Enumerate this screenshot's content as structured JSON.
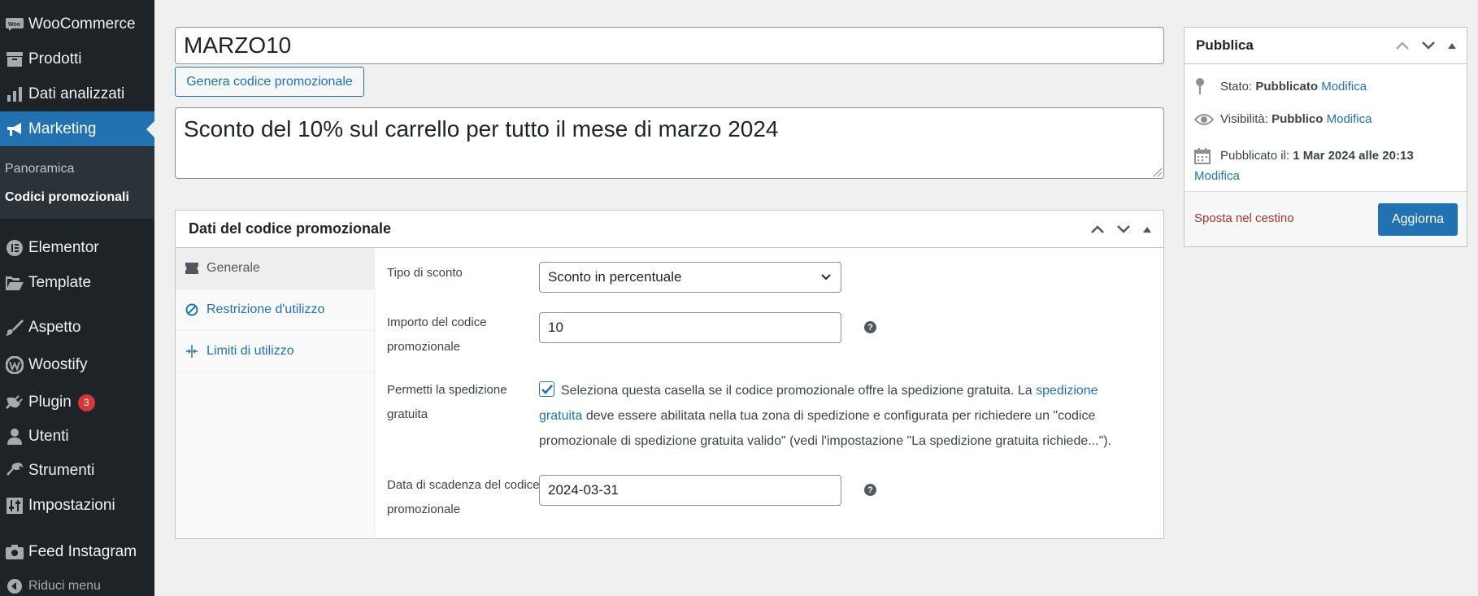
{
  "sidebar": {
    "items": [
      {
        "label": "WooCommerce"
      },
      {
        "label": "Prodotti"
      },
      {
        "label": "Dati analizzati"
      },
      {
        "label": "Marketing"
      },
      {
        "label": "Elementor"
      },
      {
        "label": "Template"
      },
      {
        "label": "Aspetto"
      },
      {
        "label": "Woostify"
      },
      {
        "label": "Plugin",
        "badge": "3"
      },
      {
        "label": "Utenti"
      },
      {
        "label": "Strumenti"
      },
      {
        "label": "Impostazioni"
      },
      {
        "label": "Feed Instagram"
      }
    ],
    "submenu": [
      "Panoramica",
      "Codici promozionali"
    ],
    "collapse_label": "Riduci menu",
    "accent_color": "#2271b1"
  },
  "coupon": {
    "code": "MARZO10",
    "generate_label": "Genera codice promozionale",
    "description": "Sconto del 10% sul carrello per tutto il mese di marzo 2024"
  },
  "panel": {
    "title": "Dati del codice promozionale",
    "tabs": [
      "Generale",
      "Restrizione d'utilizzo",
      "Limiti di utilizzo"
    ],
    "fields": {
      "discount_type_label": "Tipo di sconto",
      "discount_type_value": "Sconto in percentuale",
      "amount_label": "Importo del codice promozionale",
      "amount_value": "10",
      "free_shipping_label": "Permetti la spedizione gratuita",
      "free_shipping_text_1": "Seleziona questa casella se il codice promozionale offre la spedizione gratuita. La",
      "free_shipping_link": "spedizione gratuita",
      "free_shipping_text_2": "deve essere abilitata nella tua zona di spedizione e configurata per richiedere un \"codice promozionale di spedizione gratuita valido\" (vedi l'impostazione \"La spedizione gratuita richiede...\").",
      "expiry_label": "Data di scadenza del codice promozionale",
      "expiry_value": "2024-03-31"
    }
  },
  "publish": {
    "title": "Pubblica",
    "status_label": "Stato:",
    "status_value": "Pubblicato",
    "visibility_label": "Visibilità:",
    "visibility_value": "Pubblico",
    "published_label": "Pubblicato il:",
    "published_value": "1 Mar 2024 alle 20:13",
    "edit_link": "Modifica",
    "trash_label": "Sposta nel cestino",
    "update_label": "Aggiorna"
  }
}
